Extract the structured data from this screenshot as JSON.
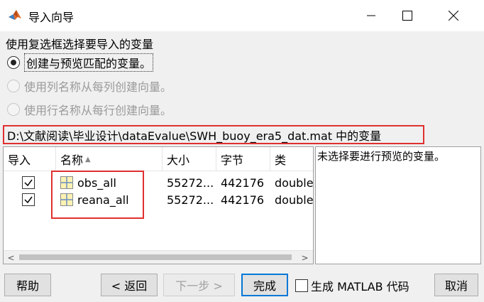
{
  "window": {
    "title": "导入向导"
  },
  "options": {
    "group_label": "使用复选框选择要导入的变量",
    "radios": [
      {
        "label": "创建与预览匹配的变量。",
        "selected": true,
        "enabled": true
      },
      {
        "label": "使用列名称从每列创建向量。",
        "selected": false,
        "enabled": false
      },
      {
        "label": "使用行名称从每行创建向量。",
        "selected": false,
        "enabled": false
      }
    ]
  },
  "source": {
    "path_label": "D:\\文献阅读\\毕业设计\\dataEvalue\\SWH_buoy_era5_dat.mat 中的变量"
  },
  "table": {
    "headers": [
      "导入",
      "名称",
      "大小",
      "字节",
      "类"
    ],
    "rows": [
      {
        "checked": true,
        "name": "obs_all",
        "size": "55272...",
        "bytes": "442176",
        "class": "double"
      },
      {
        "checked": true,
        "name": "reana_all",
        "size": "55272...",
        "bytes": "442176",
        "class": "double"
      }
    ]
  },
  "preview": {
    "message": "未选择要进行预览的变量。"
  },
  "buttons": {
    "help": "帮助",
    "back": "< 返回",
    "next": "下一步 >",
    "finish": "完成",
    "generate_code": "生成 MATLAB 代码",
    "cancel": "取消"
  },
  "icons": [
    "matlab-icon",
    "minimize-icon",
    "maximize-icon",
    "close-icon",
    "sort-ascending-icon",
    "variable-matrix-icon",
    "scroll-left-icon",
    "scroll-right-icon"
  ],
  "colors": {
    "highlight": "#e03030",
    "focus_border": "#0078d7"
  }
}
